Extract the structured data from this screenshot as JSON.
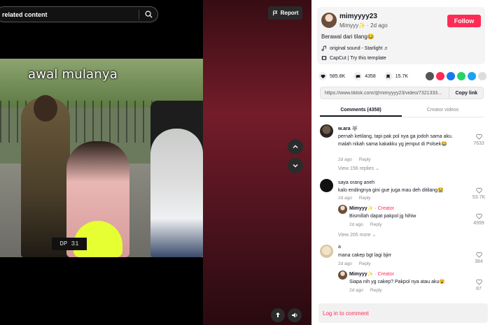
{
  "search": {
    "placeholder": "related content"
  },
  "report": {
    "label": "Report"
  },
  "video": {
    "caption": "awal mulanya",
    "plate_text": "DP 31"
  },
  "author": {
    "username": "mimyyyy23",
    "display_line": "Mimyyy✨ · 2d ago",
    "follow_label": "Follow",
    "description": "Berawal dari tilang😂",
    "sound": "original sound - Starlight ♬",
    "template": "CapCut | Try this template"
  },
  "stats": {
    "likes": "585.8K",
    "comments": "4358",
    "saves": "15.7K"
  },
  "share": {
    "link": "https://www.tiktok.com/@mimyyyy23/video/7321333...",
    "copy_label": "Copy link"
  },
  "tabs": {
    "comments": "Comments (4358)",
    "creator_videos": "Creator videos"
  },
  "comments": [
    {
      "name": "w.ara 🐺",
      "text": "pernah ketilang, tapi pak pol nya ga jodoh sama aku. malah nikah sama kakakku yg jemput di Polsek😂",
      "date": "2d ago",
      "reply": "Reply",
      "likes": "7633",
      "view_more": "View 156 replies ⌄"
    },
    {
      "name": "saya orang aneh",
      "text": "kalo endingnya gini gue juga mau deh ditilang😭",
      "date": "2d ago",
      "reply": "Reply",
      "likes": "53.7K",
      "replies": [
        {
          "name": "Mimyyy✨",
          "tag": " · Creator",
          "text": "Bismillah dapat pakpol jg hihiw",
          "date": "2d ago",
          "reply": "Reply",
          "likes": "4999"
        }
      ],
      "view_more": "View 205 more ⌄"
    },
    {
      "name": "a",
      "text": "mana cakep bgt lagi bjirr",
      "date": "2d ago",
      "reply": "Reply",
      "likes": "384",
      "replies": [
        {
          "name": "Mimyyy✨",
          "tag": " · Creator",
          "text": "Siapa nih yg cakep? Pakpol nya atau aku😮",
          "date": "2d ago",
          "reply": "Reply",
          "likes": "87"
        }
      ]
    }
  ],
  "login": {
    "label": "Log in to comment"
  },
  "colors": {
    "accent": "#fe2c55",
    "text": "#161823",
    "muted": "#8a8b91"
  },
  "icons": {
    "search": "search-icon",
    "flag": "flag-icon",
    "chevron_up": "chevron-up-icon",
    "chevron_down": "chevron-down-icon",
    "float": "floating-player-icon",
    "volume": "volume-icon",
    "heart": "heart-icon",
    "comment": "comment-icon",
    "bookmark": "bookmark-icon",
    "music": "music-note-icon",
    "template": "template-icon"
  }
}
